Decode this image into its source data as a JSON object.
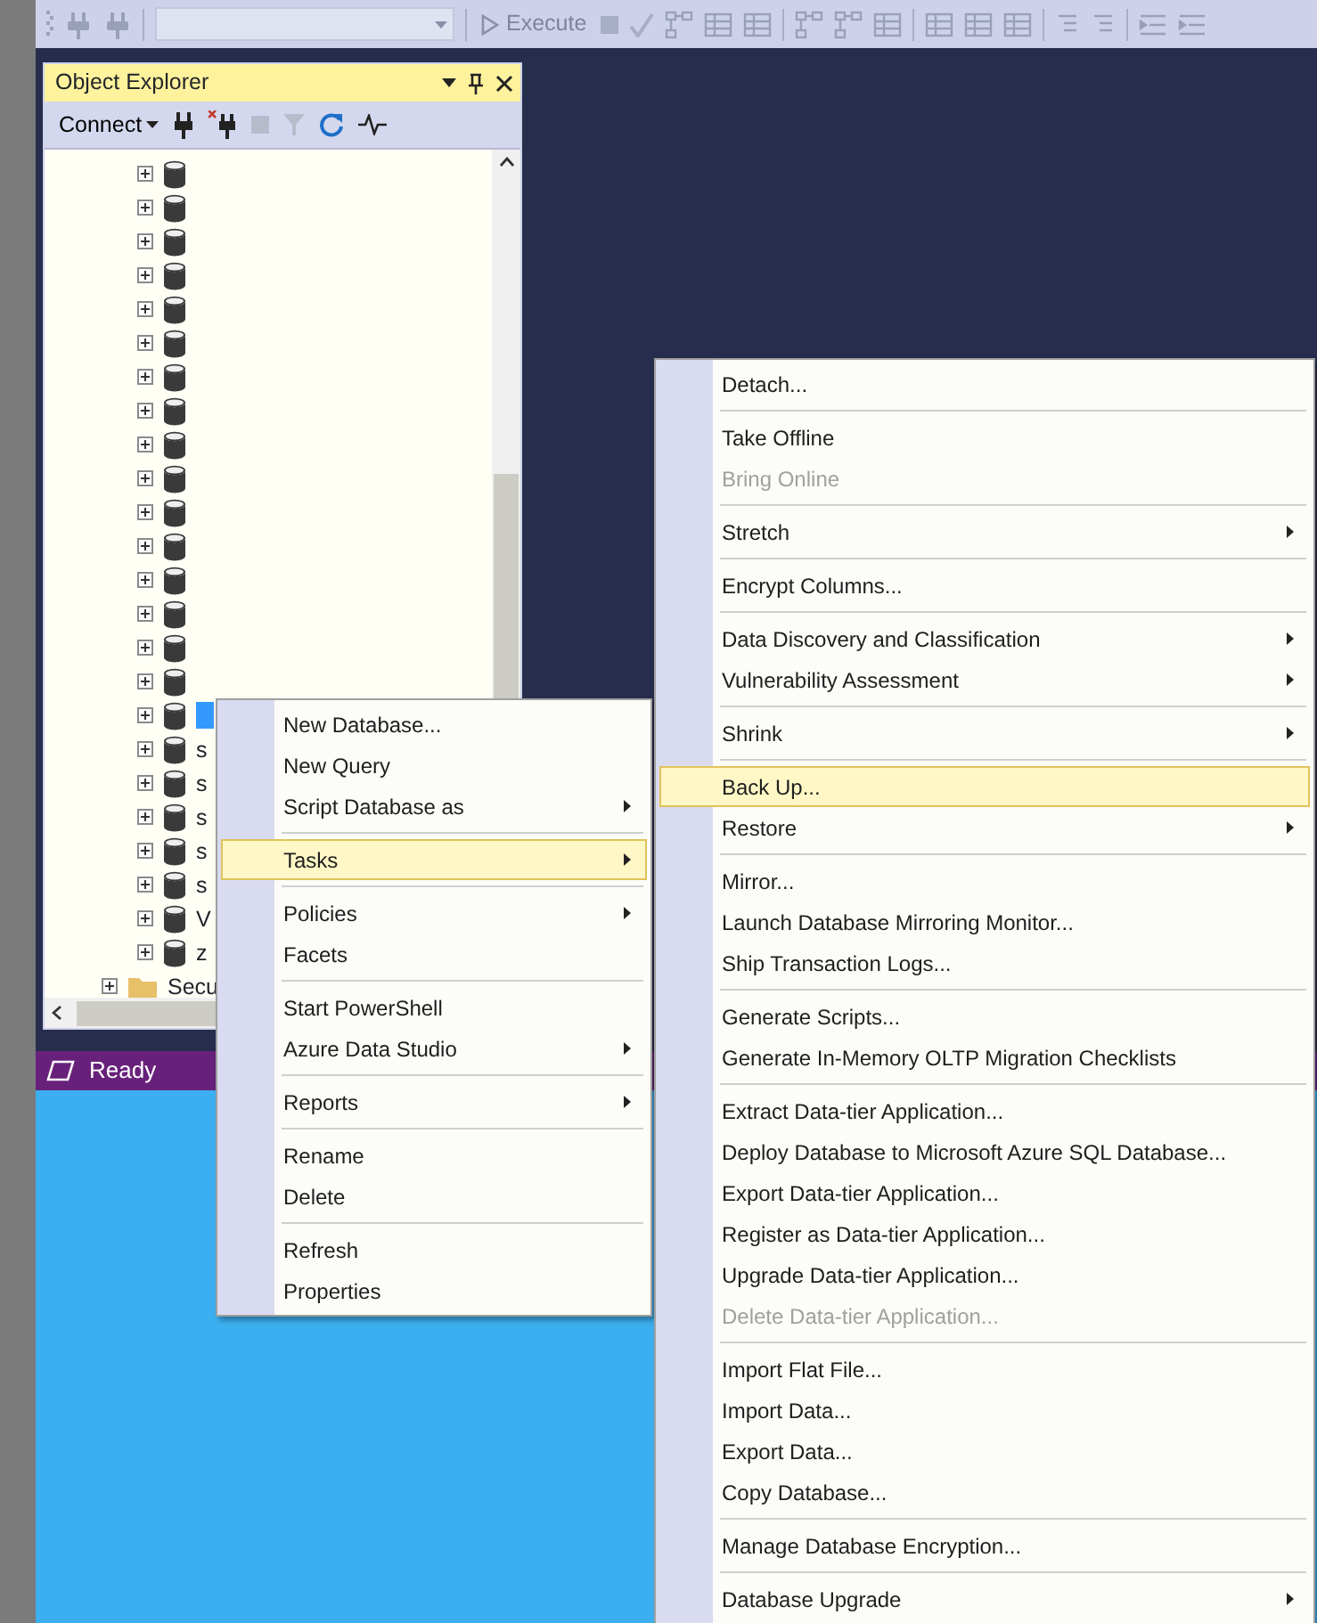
{
  "toolbar": {
    "execute": "Execute"
  },
  "object_explorer": {
    "title": "Object Explorer",
    "connect": "Connect",
    "databases": [
      {
        "selected": false
      },
      {
        "selected": false
      },
      {
        "selected": false
      },
      {
        "selected": false
      },
      {
        "selected": false
      },
      {
        "selected": false
      },
      {
        "selected": false
      },
      {
        "selected": false
      },
      {
        "selected": false
      },
      {
        "selected": false
      },
      {
        "selected": false
      },
      {
        "selected": false
      },
      {
        "selected": false
      },
      {
        "selected": false
      },
      {
        "selected": false
      },
      {
        "selected": false
      },
      {
        "selected": true
      },
      {
        "label": "s",
        "selected": false
      },
      {
        "label": "s",
        "selected": false
      },
      {
        "label": "s",
        "selected": false
      },
      {
        "label": "s",
        "selected": false
      },
      {
        "label": "s",
        "selected": false
      },
      {
        "label": "V",
        "selected": false
      },
      {
        "label": "z",
        "selected": false
      }
    ],
    "folder": {
      "label": "Secu"
    }
  },
  "status_bar": {
    "text": "Ready"
  },
  "context_menu": {
    "groups": [
      {
        "items": [
          {
            "label": "New Database...",
            "submenu": false,
            "selected": false
          },
          {
            "label": "New Query",
            "submenu": false,
            "selected": false
          },
          {
            "label": "Script Database as",
            "submenu": true,
            "selected": false
          }
        ]
      },
      {
        "items": [
          {
            "label": "Tasks",
            "submenu": true,
            "selected": true
          }
        ]
      },
      {
        "items": [
          {
            "label": "Policies",
            "submenu": true,
            "selected": false
          },
          {
            "label": "Facets",
            "submenu": false,
            "selected": false
          }
        ]
      },
      {
        "items": [
          {
            "label": "Start PowerShell",
            "submenu": false,
            "selected": false
          },
          {
            "label": "Azure Data Studio",
            "submenu": true,
            "selected": false
          }
        ]
      },
      {
        "items": [
          {
            "label": "Reports",
            "submenu": true,
            "selected": false
          }
        ]
      },
      {
        "items": [
          {
            "label": "Rename",
            "submenu": false,
            "selected": false
          },
          {
            "label": "Delete",
            "submenu": false,
            "selected": false
          }
        ]
      },
      {
        "items": [
          {
            "label": "Refresh",
            "submenu": false,
            "selected": false
          },
          {
            "label": "Properties",
            "submenu": false,
            "selected": false
          }
        ]
      }
    ]
  },
  "tasks_menu": {
    "groups": [
      {
        "items": [
          {
            "label": "Detach...",
            "submenu": false,
            "selected": false,
            "disabled": false
          }
        ]
      },
      {
        "items": [
          {
            "label": "Take Offline",
            "submenu": false,
            "selected": false,
            "disabled": false
          },
          {
            "label": "Bring Online",
            "submenu": false,
            "selected": false,
            "disabled": true
          }
        ]
      },
      {
        "items": [
          {
            "label": "Stretch",
            "submenu": true,
            "selected": false,
            "disabled": false
          }
        ]
      },
      {
        "items": [
          {
            "label": "Encrypt Columns...",
            "submenu": false,
            "selected": false,
            "disabled": false
          }
        ]
      },
      {
        "items": [
          {
            "label": "Data Discovery and Classification",
            "submenu": true,
            "selected": false,
            "disabled": false
          },
          {
            "label": "Vulnerability Assessment",
            "submenu": true,
            "selected": false,
            "disabled": false
          }
        ]
      },
      {
        "items": [
          {
            "label": "Shrink",
            "submenu": true,
            "selected": false,
            "disabled": false
          }
        ]
      },
      {
        "items": [
          {
            "label": "Back Up...",
            "submenu": false,
            "selected": true,
            "disabled": false
          },
          {
            "label": "Restore",
            "submenu": true,
            "selected": false,
            "disabled": false
          }
        ]
      },
      {
        "items": [
          {
            "label": "Mirror...",
            "submenu": false,
            "selected": false,
            "disabled": false
          },
          {
            "label": "Launch Database Mirroring Monitor...",
            "submenu": false,
            "selected": false,
            "disabled": false
          },
          {
            "label": "Ship Transaction Logs...",
            "submenu": false,
            "selected": false,
            "disabled": false
          }
        ]
      },
      {
        "items": [
          {
            "label": "Generate Scripts...",
            "submenu": false,
            "selected": false,
            "disabled": false
          },
          {
            "label": "Generate In-Memory OLTP Migration Checklists",
            "submenu": false,
            "selected": false,
            "disabled": false
          }
        ]
      },
      {
        "items": [
          {
            "label": "Extract Data-tier Application...",
            "submenu": false,
            "selected": false,
            "disabled": false
          },
          {
            "label": "Deploy Database to Microsoft Azure SQL Database...",
            "submenu": false,
            "selected": false,
            "disabled": false
          },
          {
            "label": "Export Data-tier Application...",
            "submenu": false,
            "selected": false,
            "disabled": false
          },
          {
            "label": "Register as Data-tier Application...",
            "submenu": false,
            "selected": false,
            "disabled": false
          },
          {
            "label": "Upgrade Data-tier Application...",
            "submenu": false,
            "selected": false,
            "disabled": false
          },
          {
            "label": "Delete Data-tier Application...",
            "submenu": false,
            "selected": false,
            "disabled": true
          }
        ]
      },
      {
        "items": [
          {
            "label": "Import Flat File...",
            "submenu": false,
            "selected": false,
            "disabled": false
          },
          {
            "label": "Import Data...",
            "submenu": false,
            "selected": false,
            "disabled": false
          },
          {
            "label": "Export Data...",
            "submenu": false,
            "selected": false,
            "disabled": false
          },
          {
            "label": "Copy Database...",
            "submenu": false,
            "selected": false,
            "disabled": false
          }
        ]
      },
      {
        "items": [
          {
            "label": "Manage Database Encryption...",
            "submenu": false,
            "selected": false,
            "disabled": false
          }
        ]
      },
      {
        "items": [
          {
            "label": "Database Upgrade",
            "submenu": true,
            "selected": false,
            "disabled": false
          }
        ]
      }
    ]
  }
}
